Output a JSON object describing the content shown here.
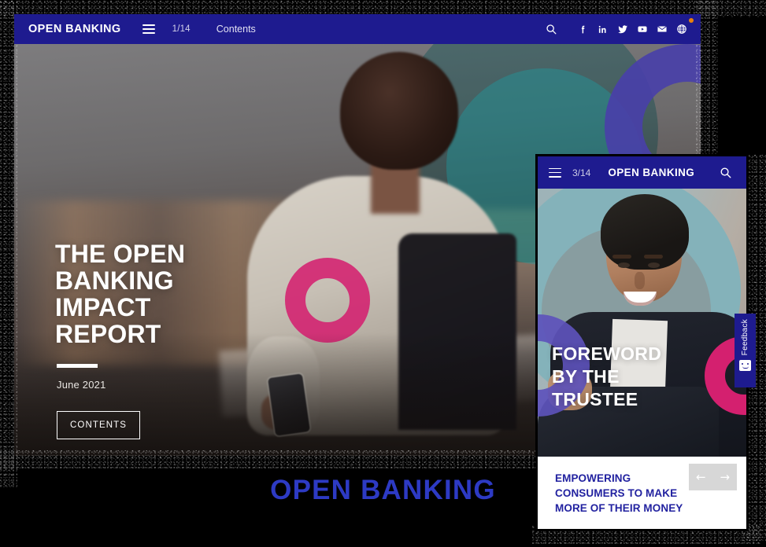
{
  "background_color": "#000000",
  "brand_blue": "#1e1b8f",
  "wordmark_blue": "#2d3ac4",
  "accent_pink": "#d4206f",
  "accent_teal": "#2bb6ba",
  "accent_indigo": "#4940a8",
  "notification_color": "#e8820c",
  "main": {
    "topbar": {
      "brand": "OPEN BANKING",
      "menu_icon": "hamburger-icon",
      "page_number": "1/14",
      "contents_link": "Contents",
      "icons": [
        {
          "name": "search-icon",
          "glyph": "search"
        },
        {
          "name": "facebook-icon",
          "glyph": "f"
        },
        {
          "name": "linkedin-icon",
          "glyph": "in"
        },
        {
          "name": "twitter-icon",
          "glyph": "twitter"
        },
        {
          "name": "youtube-icon",
          "glyph": "youtube"
        },
        {
          "name": "email-icon",
          "glyph": "envelope"
        },
        {
          "name": "globe-icon",
          "glyph": "globe"
        }
      ]
    },
    "hero": {
      "title": "THE OPEN\nBANKING\nIMPACT\nREPORT",
      "date": "June 2021",
      "contents_button": "CONTENTS"
    }
  },
  "inset": {
    "topbar": {
      "menu_icon": "hamburger-icon",
      "page_number": "3/14",
      "brand": "OPEN BANKING",
      "search_icon": "search-icon"
    },
    "hero_title": "FOREWORD\nBY THE\nTRUSTEE",
    "caption": "EMPOWERING\nCONSUMERS TO MAKE\nMORE OF THEIR MONEY",
    "slider": {
      "prev_label": "←",
      "next_label": "→"
    }
  },
  "feedback": {
    "label": "Feedback",
    "icon": "feedback-face-icon"
  },
  "footer": {
    "wordmark": "OPEN BANKING"
  }
}
